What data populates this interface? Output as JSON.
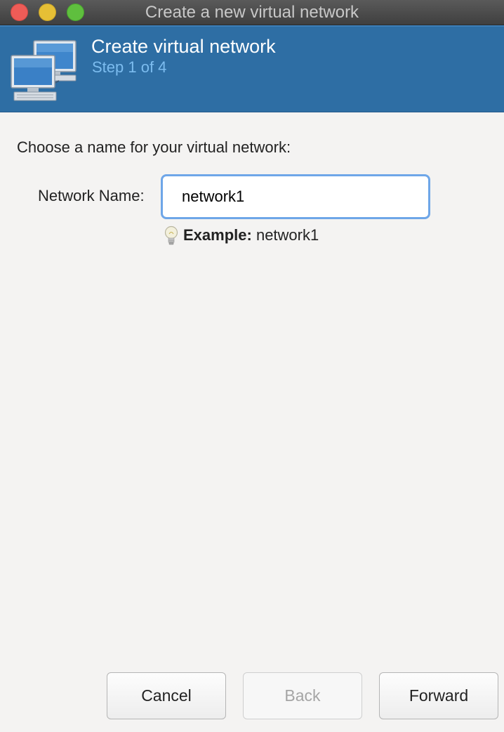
{
  "window": {
    "title": "Create a new virtual network"
  },
  "header": {
    "title": "Create virtual network",
    "step": "Step 1 of 4",
    "icon": "network-computers-icon",
    "bg_color": "#2e6ea4",
    "step_color": "#7cbcef"
  },
  "form": {
    "prompt": "Choose a name for your virtual network:",
    "name_label": "Network Name:",
    "name_value": "network1",
    "hint_label": "Example:",
    "hint_value": "network1",
    "hint_icon": "lightbulb-icon"
  },
  "buttons": {
    "cancel": "Cancel",
    "back": "Back",
    "forward": "Forward"
  }
}
